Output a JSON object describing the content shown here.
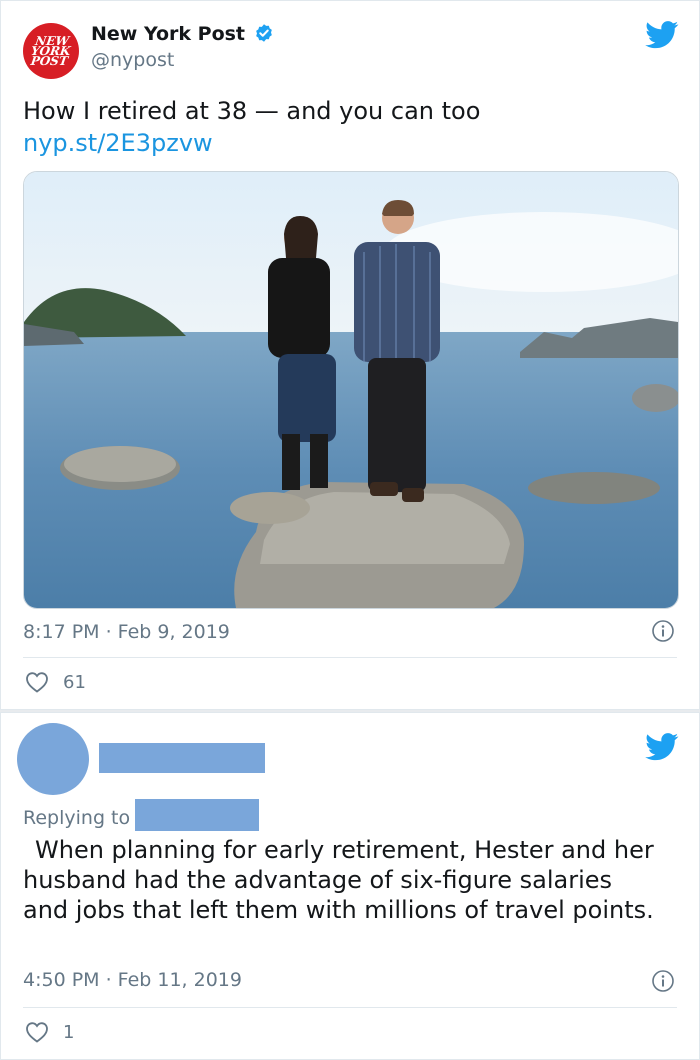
{
  "tweet1": {
    "logo_text": "NEW\nYORK\nPOST",
    "display_name": "New York Post",
    "handle": "@nypost",
    "text": "How I retired at 38 — and you can too",
    "link": "nyp.st/2E3pzvw",
    "timestamp": "8:17 PM · Feb 9, 2019",
    "likes": "61"
  },
  "tweet2": {
    "replying_to_label": "Replying to",
    "text": "When planning for early retirement, Hester and her husband had the advantage of six-figure salaries and jobs that left them with millions of travel points.",
    "timestamp": "4:50 PM · Feb 11, 2019",
    "likes": "1"
  },
  "colors": {
    "twitter_blue": "#1da1f2",
    "link_blue": "#1b95e0",
    "nypost_red": "#d71e25",
    "redaction_blue": "#7aa6da",
    "secondary_text": "#657786"
  },
  "icons": [
    "verified-badge-icon",
    "twitter-bird-icon",
    "info-icon",
    "heart-icon"
  ]
}
